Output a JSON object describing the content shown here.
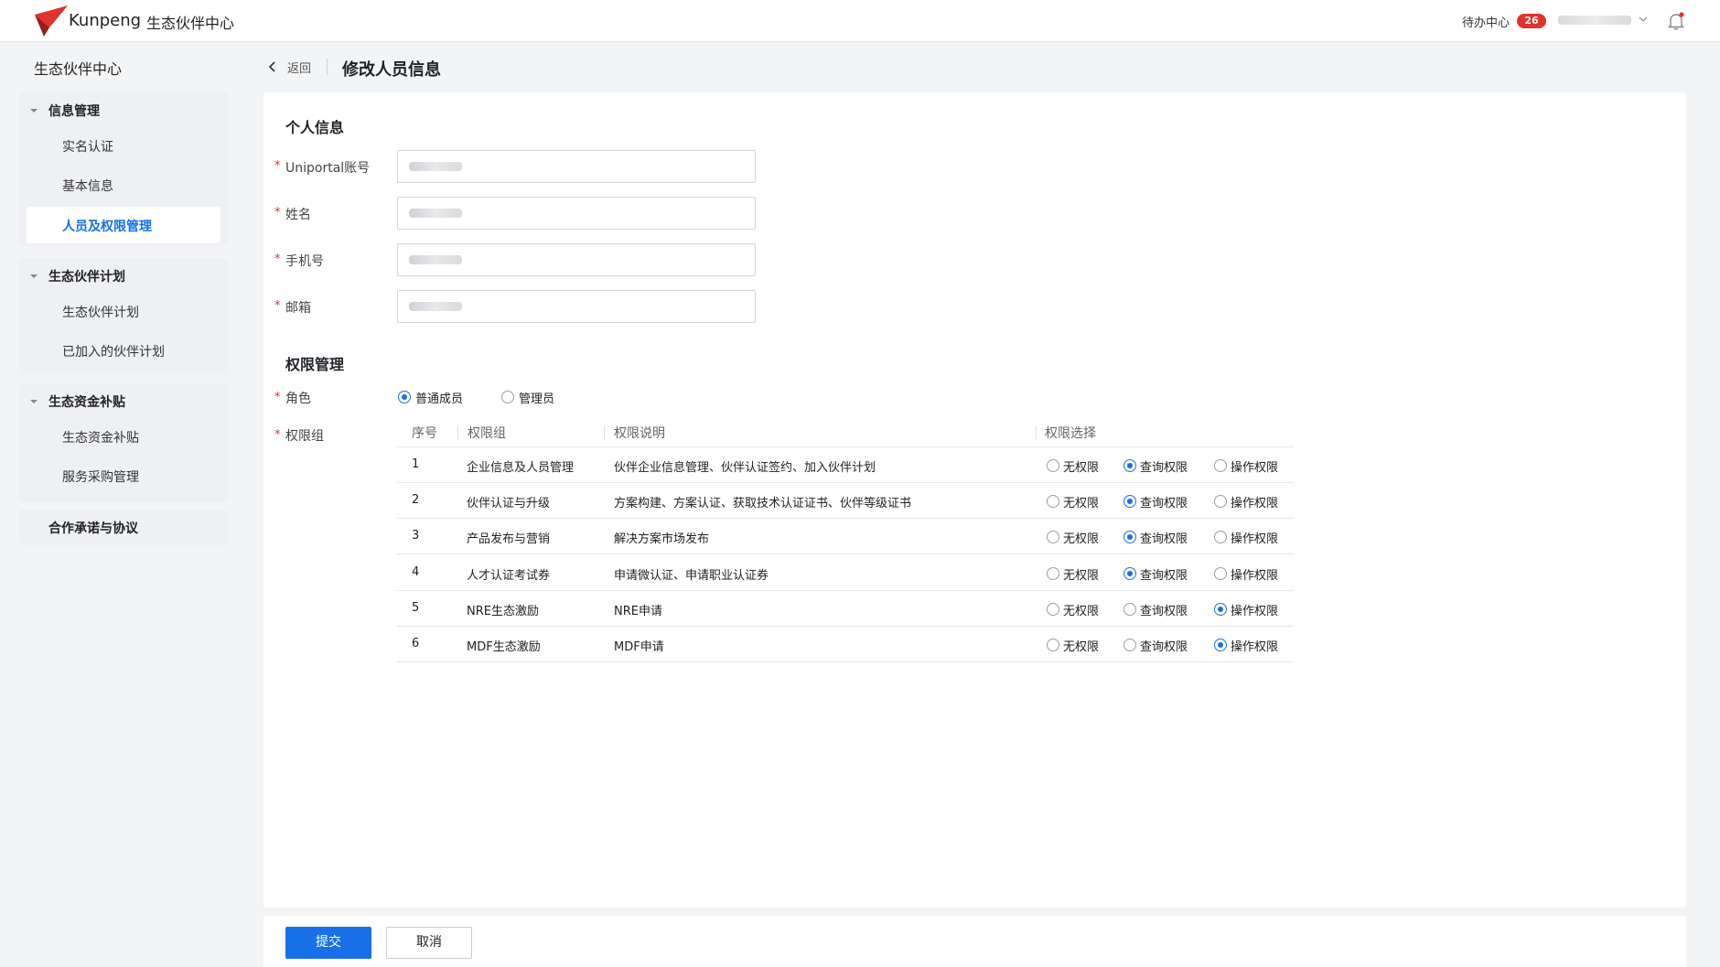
{
  "header": {
    "brand": "Kunpeng",
    "app_title": "生态伙伴中心",
    "todo_label": "待办中心",
    "todo_count": "26",
    "brand_color": "#e0322f"
  },
  "sidebar": {
    "title": "生态伙伴中心",
    "groups": [
      {
        "label": "信息管理",
        "items": [
          {
            "label": "实名认证"
          },
          {
            "label": "基本信息"
          },
          {
            "label": "人员及权限管理",
            "active": true
          }
        ]
      },
      {
        "label": "生态伙伴计划",
        "items": [
          {
            "label": "生态伙伴计划"
          },
          {
            "label": "已加入的伙伴计划"
          }
        ]
      },
      {
        "label": "生态资金补贴",
        "items": [
          {
            "label": "生态资金补贴"
          },
          {
            "label": "服务采购管理"
          }
        ]
      },
      {
        "label": "合作承诺与协议",
        "items": []
      }
    ]
  },
  "page": {
    "back_label": "返回",
    "title": "修改人员信息"
  },
  "personal": {
    "section_title": "个人信息",
    "fields": [
      {
        "label": "Uniportal账号",
        "required": "*"
      },
      {
        "label": "姓名",
        "required": "*"
      },
      {
        "label": "手机号",
        "required": "*"
      },
      {
        "label": "邮箱",
        "required": "*"
      }
    ]
  },
  "permission": {
    "section_title": "权限管理",
    "role_label": "角色",
    "role_options": [
      {
        "label": "普通成员",
        "selected": true
      },
      {
        "label": "管理员",
        "selected": false
      }
    ],
    "group_label": "权限组",
    "columns": [
      "序号",
      "权限组",
      "权限说明",
      "权限选择"
    ],
    "option_labels": [
      "无权限",
      "查询权限",
      "操作权限"
    ],
    "rows": [
      {
        "no": "1",
        "group": "企业信息及人员管理",
        "desc": "伙伴企业信息管理、伙伴认证签约、加入伙伴计划",
        "selected": 1
      },
      {
        "no": "2",
        "group": "伙伴认证与升级",
        "desc": "方案构建、方案认证、获取技术认证证书、伙伴等级证书",
        "selected": 1
      },
      {
        "no": "3",
        "group": "产品发布与营销",
        "desc": "解决方案市场发布",
        "selected": 1
      },
      {
        "no": "4",
        "group": "人才认证考试券",
        "desc": "申请微认证、申请职业认证券",
        "selected": 1
      },
      {
        "no": "5",
        "group": "NRE生态激励",
        "desc": "NRE申请",
        "selected": 2
      },
      {
        "no": "6",
        "group": "MDF生态激励",
        "desc": "MDF申请",
        "selected": 2
      }
    ]
  },
  "footer": {
    "submit_label": "提交",
    "cancel_label": "取消"
  },
  "colors": {
    "accent": "#1870e8",
    "required": "#e0322f"
  }
}
